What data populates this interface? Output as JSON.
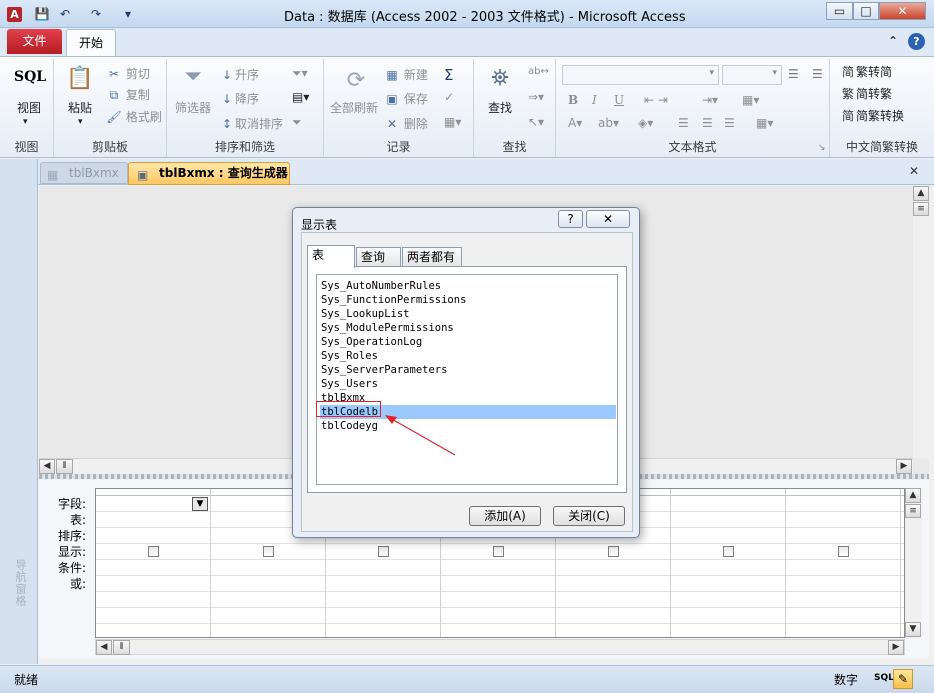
{
  "window": {
    "title": "Data : 数据库 (Access 2002 - 2003 文件格式)  -  Microsoft Access",
    "app_icon": "A",
    "minimize": "▭",
    "maximize": "□",
    "close": "✕"
  },
  "qat": {
    "save": "💾",
    "undo": "↶",
    "redo": "↷",
    "customize": "▾"
  },
  "ribbon_tabs": {
    "file": "文件",
    "home": "开始",
    "collapse": "⌃",
    "help": "?"
  },
  "ribbon": {
    "views": {
      "sql": "SQL",
      "view": "视图",
      "label": "视图"
    },
    "clipboard": {
      "paste": "粘贴",
      "cut": "剪切",
      "copy": "复制",
      "format_painter": "格式刷",
      "label": "剪贴板"
    },
    "sort_filter": {
      "filter": "筛选器",
      "ascending": "升序",
      "descending": "降序",
      "clear_sort": "取消排序",
      "label": "排序和筛选"
    },
    "records": {
      "refresh": "全部刷新",
      "new": "新建",
      "save": "保存",
      "delete": "删除",
      "label": "记录"
    },
    "find": {
      "find": "查找",
      "label": "查找"
    },
    "text_format": {
      "bold": "B",
      "italic": "I",
      "underline": "U",
      "label": "文本格式"
    },
    "chinese": {
      "to_simplified": "繁转简",
      "to_traditional": "简转繁",
      "convert": "简繁转换",
      "label": "中文简繁转换"
    }
  },
  "doc_tabs": {
    "tab1": "tblBxmx",
    "tab2": "tblBxmx : 查询生成器",
    "close": "✕",
    "nav_toggle": "»"
  },
  "nav_pane": {
    "label": "导航窗格"
  },
  "query_grid": {
    "labels": {
      "field": "字段:",
      "table": "表:",
      "sort": "排序:",
      "show": "显示:",
      "criteria": "条件:",
      "or": "或:"
    },
    "columns": 7
  },
  "dialog": {
    "title": "显示表",
    "help": "?",
    "close": "✕",
    "tabs": [
      "表",
      "查询",
      "两者都有"
    ],
    "tables": [
      "Sys_AutoNumberRules",
      "Sys_FunctionPermissions",
      "Sys_LookupList",
      "Sys_ModulePermissions",
      "Sys_OperationLog",
      "Sys_Roles",
      "Sys_ServerParameters",
      "Sys_Users",
      "tblBxmx",
      "tblCodelb",
      "tblCodeyg"
    ],
    "selected_index": 9,
    "add_button": "添加(A)",
    "close_button": "关闭(C)"
  },
  "status": {
    "left": "就绪",
    "num": "数字",
    "sql": "SQL"
  }
}
